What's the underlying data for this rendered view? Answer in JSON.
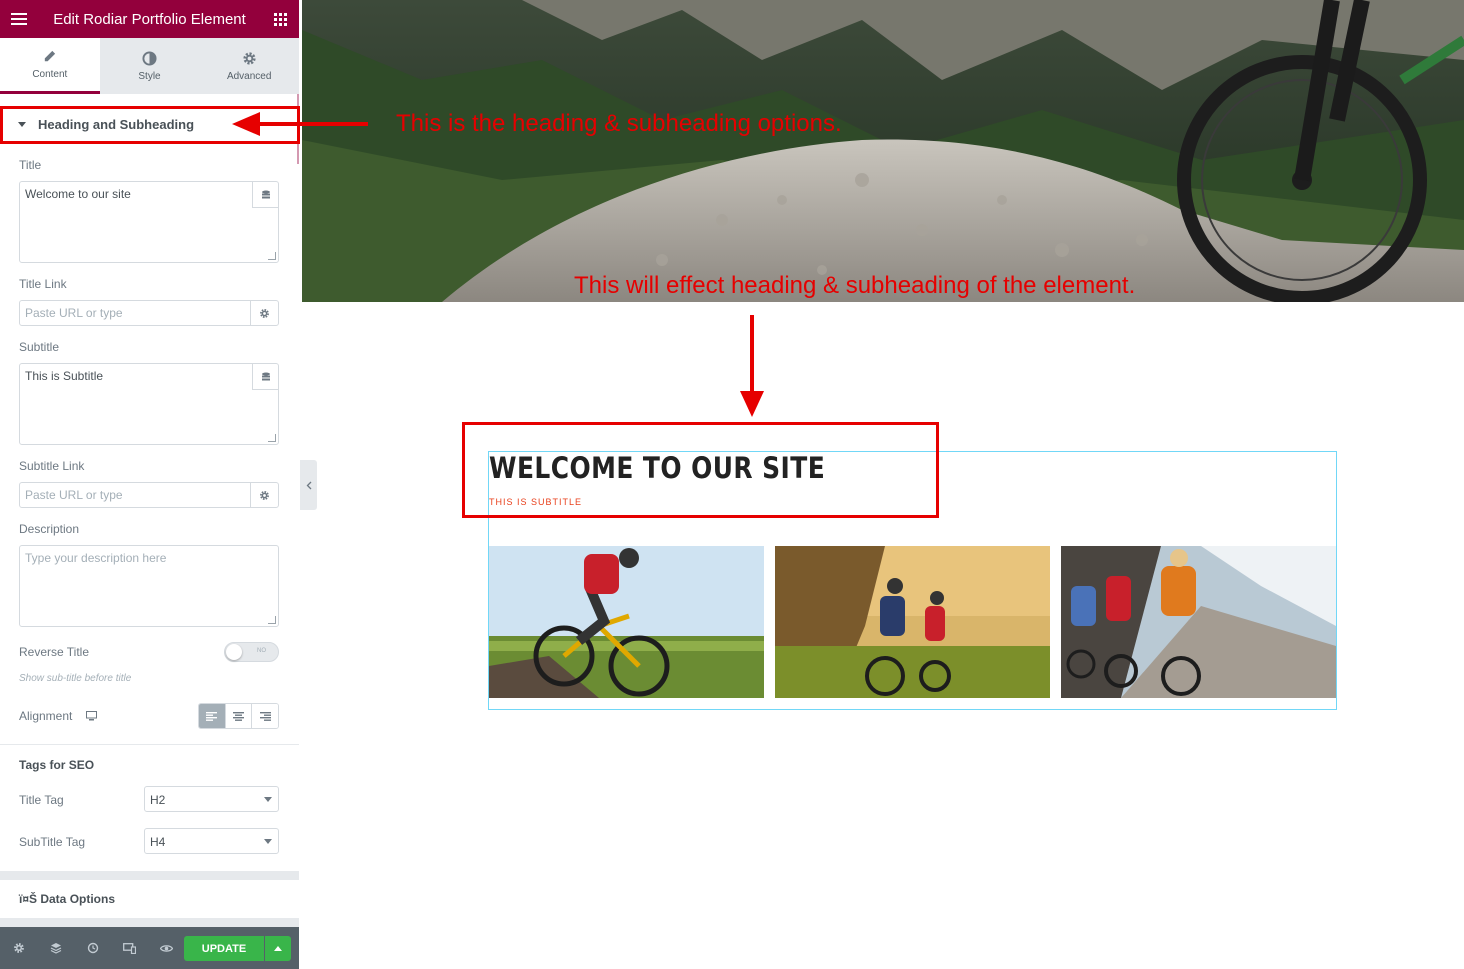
{
  "panel": {
    "title": "Edit Rodiar Portfolio Element",
    "tabs": [
      {
        "label": "Content",
        "icon": "pencil-icon"
      },
      {
        "label": "Style",
        "icon": "contrast-icon"
      },
      {
        "label": "Advanced",
        "icon": "gear-icon"
      }
    ],
    "section_title": "Heading and Subheading",
    "title_label": "Title",
    "title_value": "Welcome to our site",
    "title_link_label": "Title Link",
    "title_link_placeholder": "Paste URL or type",
    "subtitle_label": "Subtitle",
    "subtitle_value": "This is Subtitle",
    "subtitle_link_label": "Subtitle Link",
    "subtitle_link_placeholder": "Paste URL or type",
    "description_label": "Description",
    "description_placeholder": "Type your description here",
    "reverse_label": "Reverse Title",
    "reverse_state": "NO",
    "reverse_help": "Show sub-title before title",
    "alignment_label": "Alignment",
    "alignment_selected": "left",
    "seo_heading": "Tags for SEO",
    "title_tag_label": "Title Tag",
    "title_tag_value": "H2",
    "subtitle_tag_label": "SubTitle Tag",
    "subtitle_tag_value": "H4",
    "data_options_label": "ï¤Š Data Options"
  },
  "footer": {
    "update_label": "UPDATE",
    "icons": [
      "settings-icon",
      "navigator-icon",
      "history-icon",
      "responsive-icon",
      "preview-eye-icon"
    ]
  },
  "annotations": {
    "top": "This is the heading & subheading options.",
    "middle": "This will effect heading & subheading of the element."
  },
  "preview": {
    "title": "WELCOME TO OUR SITE",
    "subtitle": "THIS IS SUBTITLE"
  },
  "colors": {
    "brand": "#93003c",
    "update": "#39b54a",
    "annotation": "#e60000",
    "subtitle": "#e8401c",
    "widget_outline": "#71d7f7"
  }
}
